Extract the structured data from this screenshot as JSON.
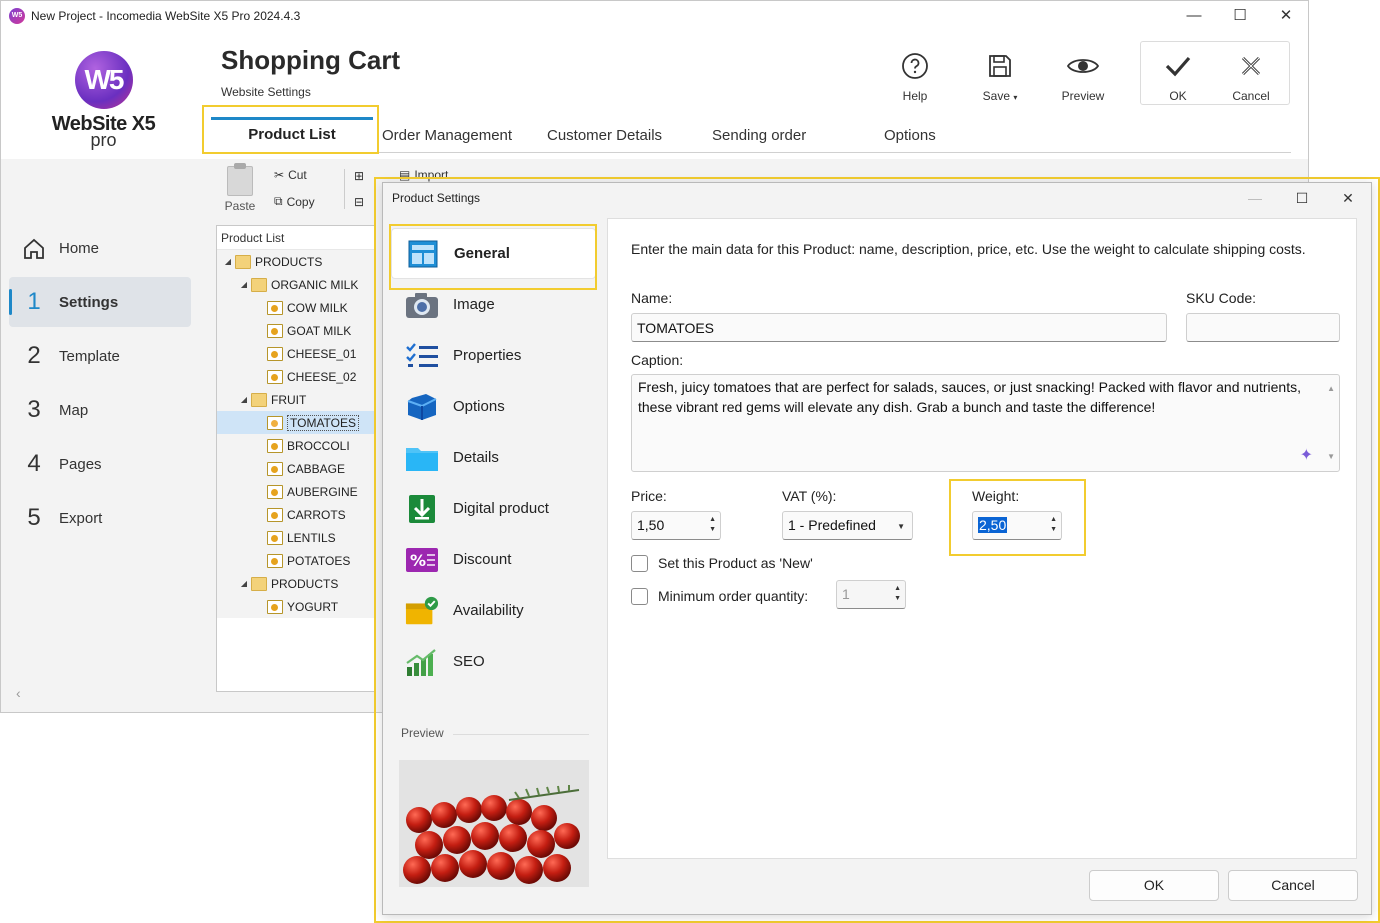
{
  "window": {
    "title": "New Project - Incomedia WebSite X5 Pro 2024.4.3",
    "app_icon": "W5"
  },
  "logo": {
    "mark": "W5",
    "name": "WebSite X5",
    "edition": "pro"
  },
  "header": {
    "title": "Shopping Cart",
    "subtitle": "Website Settings",
    "buttons": {
      "help": "Help",
      "save": "Save",
      "preview": "Preview",
      "ok": "OK",
      "cancel": "Cancel"
    }
  },
  "tabs": [
    "Product List",
    "Order Management",
    "Customer Details",
    "Sending order",
    "Options"
  ],
  "sidebar": [
    {
      "num": "",
      "label": "Home"
    },
    {
      "num": "1",
      "label": "Settings"
    },
    {
      "num": "2",
      "label": "Template"
    },
    {
      "num": "3",
      "label": "Map"
    },
    {
      "num": "4",
      "label": "Pages"
    },
    {
      "num": "5",
      "label": "Export"
    }
  ],
  "toolbar": {
    "paste": "Paste",
    "cut": "Cut",
    "copy": "Copy",
    "import": "Import"
  },
  "tree": {
    "header": "Product List",
    "rows": [
      {
        "label": "PRODUCTS",
        "level": 0,
        "type": "folder",
        "expanded": true
      },
      {
        "label": "ORGANIC MILK",
        "level": 1,
        "type": "folder",
        "expanded": true
      },
      {
        "label": "COW MILK",
        "level": 2,
        "type": "doc"
      },
      {
        "label": "GOAT MILK",
        "level": 2,
        "type": "doc"
      },
      {
        "label": "CHEESE_01",
        "level": 2,
        "type": "doc"
      },
      {
        "label": "CHEESE_02",
        "level": 2,
        "type": "doc"
      },
      {
        "label": "FRUIT",
        "level": 1,
        "type": "folder",
        "expanded": true
      },
      {
        "label": "TOMATOES",
        "level": 2,
        "type": "doc",
        "selected": true
      },
      {
        "label": "BROCCOLI",
        "level": 2,
        "type": "doc"
      },
      {
        "label": "CABBAGE",
        "level": 2,
        "type": "doc"
      },
      {
        "label": "AUBERGINE",
        "level": 2,
        "type": "doc"
      },
      {
        "label": "CARROTS",
        "level": 2,
        "type": "doc"
      },
      {
        "label": "LENTILS",
        "level": 2,
        "type": "doc"
      },
      {
        "label": "POTATOES",
        "level": 2,
        "type": "doc"
      },
      {
        "label": "PRODUCTS",
        "level": 1,
        "type": "folder",
        "expanded": true
      },
      {
        "label": "YOGURT",
        "level": 2,
        "type": "doc"
      }
    ]
  },
  "dialog": {
    "title": "Product Settings",
    "nav": [
      {
        "label": "General",
        "icon": "general-icon"
      },
      {
        "label": "Image",
        "icon": "camera-icon"
      },
      {
        "label": "Properties",
        "icon": "checklist-icon"
      },
      {
        "label": "Options",
        "icon": "cube-icon"
      },
      {
        "label": "Details",
        "icon": "folder-icon"
      },
      {
        "label": "Digital product",
        "icon": "download-icon"
      },
      {
        "label": "Discount",
        "icon": "percent-icon"
      },
      {
        "label": "Availability",
        "icon": "box-check-icon"
      },
      {
        "label": "SEO",
        "icon": "growth-chart-icon"
      }
    ],
    "preview_label": "Preview",
    "description": "Enter the main data for this Product: name, description, price, etc. Use the weight to calculate shipping costs.",
    "fields": {
      "name_label": "Name:",
      "name_value": "TOMATOES",
      "sku_label": "SKU Code:",
      "sku_value": "",
      "caption_label": "Caption:",
      "caption_value": "Fresh, juicy tomatoes that are perfect for salads, sauces, or just snacking! Packed with flavor and nutrients, these vibrant red gems will elevate any dish. Grab a bunch and taste the difference!",
      "price_label": "Price:",
      "price_value": "1,50",
      "vat_label": "VAT (%):",
      "vat_value": "1 - Predefined",
      "weight_label": "Weight:",
      "weight_value": "2,50",
      "new_label": "Set this Product as 'New'",
      "new_checked": false,
      "minqty_label": "Minimum order quantity:",
      "minqty_checked": false,
      "minqty_value": "1"
    },
    "ok": "OK",
    "cancel": "Cancel"
  },
  "colors": {
    "accent": "#1e88c8",
    "highlight": "#f2cc2f",
    "selection": "#0a64d4"
  }
}
